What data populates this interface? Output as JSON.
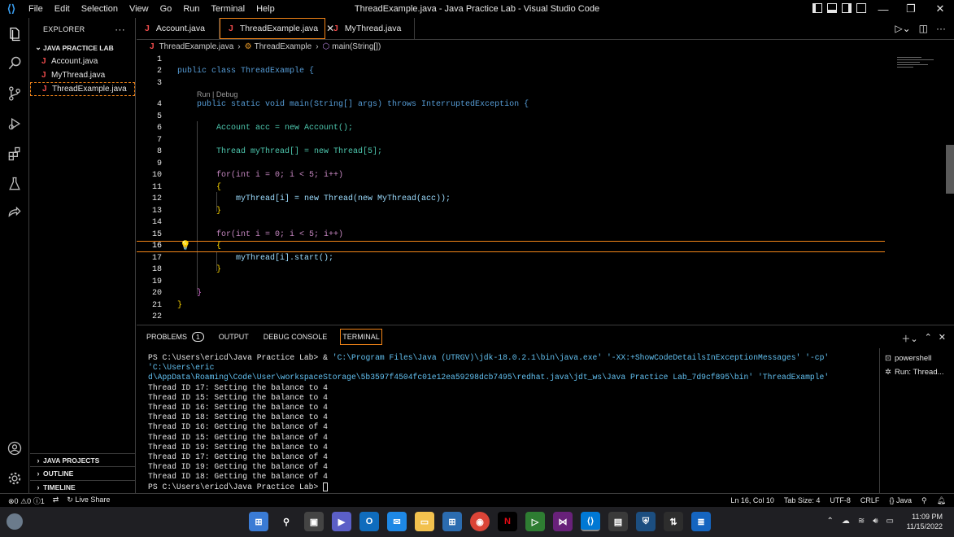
{
  "app": {
    "title": "ThreadExample.java - Java Practice Lab - Visual Studio Code",
    "menu": [
      "File",
      "Edit",
      "Selection",
      "View",
      "Go",
      "Run",
      "Terminal",
      "Help"
    ],
    "accent": "#f38518"
  },
  "sidebar": {
    "header": "EXPLORER",
    "more": "···",
    "folder": "JAVA PRACTICE LAB",
    "files": [
      "Account.java",
      "MyThread.java",
      "ThreadExample.java"
    ],
    "sections": [
      "JAVA PROJECTS",
      "OUTLINE",
      "TIMELINE"
    ]
  },
  "tabs": [
    {
      "label": "Account.java"
    },
    {
      "label": "ThreadExample.java",
      "close": "✕"
    },
    {
      "label": "MyThread.java"
    }
  ],
  "breadcrumb": {
    "file": "ThreadExample.java",
    "class": "ThreadExample",
    "method": "main(String[])"
  },
  "editor": {
    "codelens": "Run | Debug",
    "line_numbers": [
      "1",
      "2",
      "3",
      "4",
      "5",
      "6",
      "7",
      "8",
      "9",
      "10",
      "11",
      "12",
      "13",
      "14",
      "15",
      "16",
      "17",
      "18",
      "19",
      "20",
      "21",
      "22"
    ],
    "lines": [
      "",
      "public class ThreadExample {",
      "",
      "    public static void main(String[] args) throws InterruptedException {",
      "",
      "        Account acc = new Account();",
      "",
      "        Thread myThread[] = new Thread[5];",
      "",
      "        for(int i = 0; i < 5; i++)",
      "        {",
      "            myThread[i] = new Thread(new MyThread(acc));",
      "        }",
      "",
      "        for(int i = 0; i < 5; i++)",
      "        {",
      "            myThread[i].start();",
      "        }",
      "",
      "    }",
      "}",
      ""
    ]
  },
  "panel": {
    "tabs": [
      "PROBLEMS",
      "OUTPUT",
      "DEBUG CONSOLE",
      "TERMINAL"
    ],
    "problems_count": "1",
    "terminals": [
      "powershell",
      "Run: Thread..."
    ],
    "prompt": "PS C:\\Users\\ericd\\Java Practice Lab>",
    "command_amp": "&",
    "command_exe": "'C:\\Program Files\\Java (UTRGV)\\jdk-18.0.2.1\\bin\\java.exe'",
    "command_opt": "'-XX:+ShowCodeDetailsInExceptionMessages' '-cp'",
    "command_cp1": "'C:\\Users\\eric",
    "command_cp2": "d\\AppData\\Roaming\\Code\\User\\workspaceStorage\\5b3597f4504fc01e12ea59298dcb7495\\redhat.java\\jdt_ws\\Java Practice Lab_7d9cf895\\bin'",
    "command_main": "'ThreadExample'",
    "output": [
      "Thread ID 17: Setting the balance to 4",
      "Thread ID 15: Setting the balance to 4",
      "Thread ID 16: Setting the balance to 4",
      "Thread ID 18: Setting the balance to 4",
      "Thread ID 16: Getting the balance of 4",
      "Thread ID 15: Getting the balance of 4",
      "Thread ID 19: Setting the balance to 4",
      "Thread ID 17: Getting the balance of 4",
      "Thread ID 19: Getting the balance of 4",
      "Thread ID 18: Getting the balance of 4"
    ]
  },
  "status": {
    "errors": "0",
    "warnings": "0",
    "info": "1",
    "live_share": "Live Share",
    "position": "Ln 16, Col 10",
    "tab_size": "Tab Size: 4",
    "encoding": "UTF-8",
    "eol": "CRLF",
    "language": "Java"
  },
  "taskbar": {
    "time": "11:09 PM",
    "date": "11/15/2022"
  }
}
